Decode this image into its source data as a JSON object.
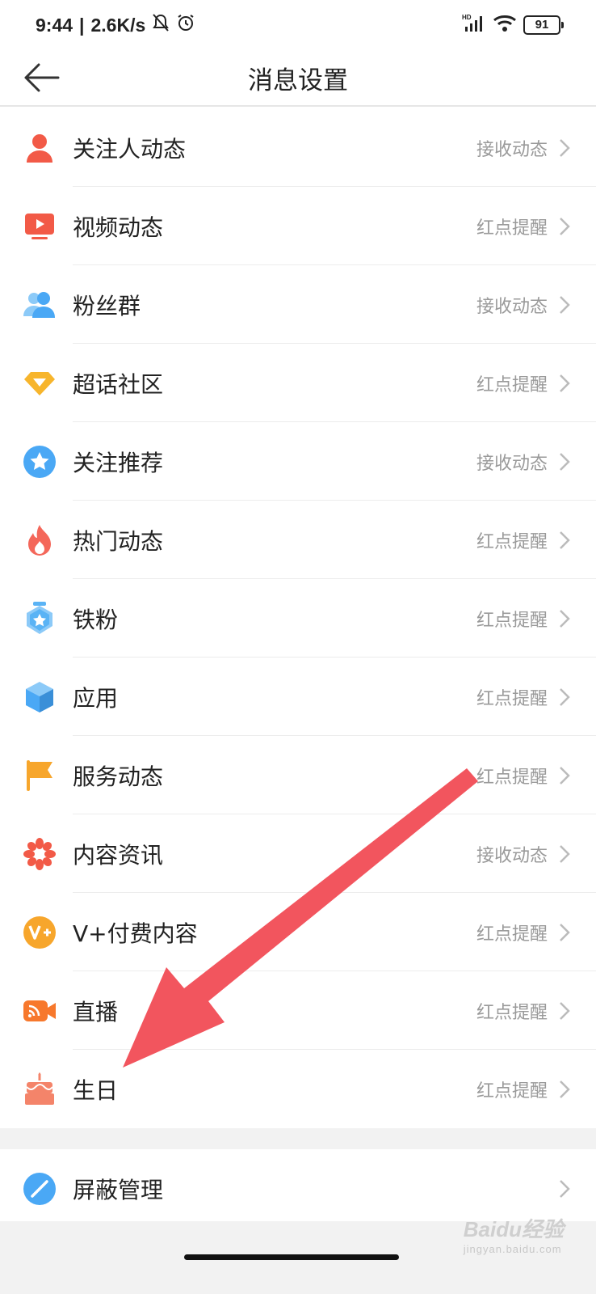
{
  "status_bar": {
    "time": "9:44",
    "speed": "2.6K/s",
    "network": "HD",
    "battery": "91"
  },
  "header": {
    "title": "消息设置"
  },
  "items": [
    {
      "label": "关注人动态",
      "value": "接收动态",
      "icon": "person-icon",
      "color": "#f25a47"
    },
    {
      "label": "视频动态",
      "value": "红点提醒",
      "icon": "video-icon",
      "color": "#f25a47"
    },
    {
      "label": "粉丝群",
      "value": "接收动态",
      "icon": "group-icon",
      "color": "#4aa8f5"
    },
    {
      "label": "超话社区",
      "value": "红点提醒",
      "icon": "diamond-icon",
      "color": "#f7b52c"
    },
    {
      "label": "关注推荐",
      "value": "接收动态",
      "icon": "star-icon",
      "color": "#4aa8f5"
    },
    {
      "label": "热门动态",
      "value": "红点提醒",
      "icon": "flame-icon",
      "color": "#f4675a"
    },
    {
      "label": "铁粉",
      "value": "红点提醒",
      "icon": "badge-icon",
      "color": "#5ab3f5"
    },
    {
      "label": "应用",
      "value": "红点提醒",
      "icon": "cube-icon",
      "color": "#4aa8f5"
    },
    {
      "label": "服务动态",
      "value": "红点提醒",
      "icon": "flag-icon",
      "color": "#f7a62c"
    },
    {
      "label": "内容资讯",
      "value": "接收动态",
      "icon": "flower-icon",
      "color": "#f25a47"
    },
    {
      "label": "V+付费内容",
      "value": "红点提醒",
      "icon": "vplus-icon",
      "color": "#f7a62c"
    },
    {
      "label": "直播",
      "value": "红点提醒",
      "icon": "live-icon",
      "color": "#f7782c"
    },
    {
      "label": "生日",
      "value": "红点提醒",
      "icon": "cake-icon",
      "color": "#f4846a"
    }
  ],
  "footer_item": {
    "label": "屏蔽管理",
    "icon": "block-icon",
    "color": "#4aa8f5"
  },
  "watermark": {
    "brand": "Baidu经验",
    "url": "jingyan.baidu.com"
  }
}
